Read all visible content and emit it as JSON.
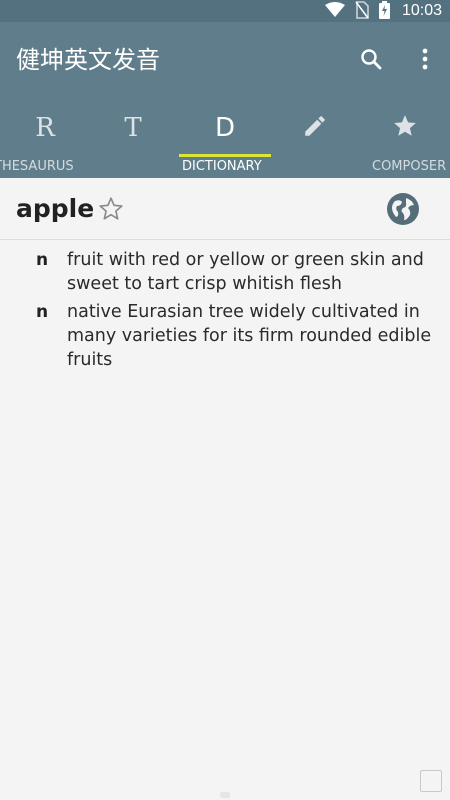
{
  "status_bar": {
    "time": "10:03"
  },
  "app_bar": {
    "title": "健坤英文发音"
  },
  "tabs": [
    {
      "letter": "R",
      "label": ""
    },
    {
      "letter": "T",
      "label": "THESAURUS"
    },
    {
      "letter": "D",
      "label": "DICTIONARY"
    },
    {
      "letter": "",
      "label": ""
    },
    {
      "letter": "",
      "label": "COMPOSER"
    }
  ],
  "active_tab": "DICTIONARY",
  "word": "apple",
  "definitions": [
    {
      "pos": "n",
      "text": "fruit with red or yellow or green skin and sweet to tart crisp whitish flesh"
    },
    {
      "pos": "n",
      "text": "native Eurasian tree widely cultivated in many varieties for its firm rounded edible fruits"
    }
  ],
  "colors": {
    "primary": "#607d8b",
    "status": "#547180",
    "indicator": "#d8e635"
  },
  "icons": {
    "search": "search-icon",
    "more": "more-vert-icon",
    "edit": "pencil-icon",
    "favorites": "star-icon",
    "favorite_word": "star-outline-icon",
    "pronounce": "globe-icon"
  }
}
